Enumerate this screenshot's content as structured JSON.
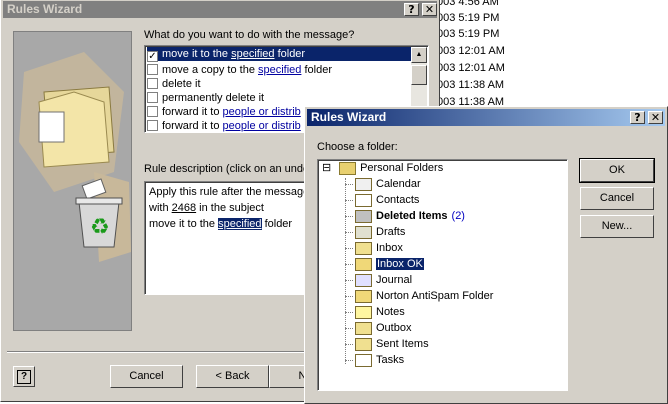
{
  "background_list": {
    "times": [
      "003 4:56 AM",
      "003 5:19 PM",
      "003 5:19 PM",
      "003 12:01 AM",
      "003 12:01 AM",
      "003 11:38 AM",
      "003 11:38 AM"
    ]
  },
  "rules_wizard": {
    "title": "Rules Wizard",
    "help_btn": "?",
    "close_btn": "✕",
    "question": "What do you want to do with the message?",
    "actions": [
      {
        "pre": "move it to the ",
        "link": "specified",
        "post": " folder",
        "checked": "✓"
      },
      {
        "pre": "move a copy to the ",
        "link": "specified",
        "post": " folder",
        "checked": ""
      },
      {
        "pre": "delete it",
        "link": "",
        "post": "",
        "checked": ""
      },
      {
        "pre": "permanently delete it",
        "link": "",
        "post": "",
        "checked": ""
      },
      {
        "pre": "forward it to ",
        "link": "people or distrib",
        "post": "",
        "checked": ""
      },
      {
        "pre": "forward it to ",
        "link": "people or distrib",
        "post": "",
        "checked": ""
      }
    ],
    "description_label": "Rule description (click on an unde",
    "description": {
      "line1": "Apply this rule after the message",
      "line2_pre": "with ",
      "line2_link": "2468",
      "line2_post": " in the subject",
      "line3_pre": "move it to the ",
      "line3_link": "specified",
      "line3_post": " folder"
    },
    "buttons": {
      "cancel": "Cancel",
      "back": "< Back",
      "next": "Ne"
    }
  },
  "folder_dialog": {
    "title": "Rules Wizard",
    "help_btn": "?",
    "close_btn": "✕",
    "prompt": "Choose a folder:",
    "tree_expander": "⊟",
    "root": "Personal Folders",
    "folders": [
      {
        "name": "Calendar",
        "icon": "calendar-icon",
        "bold": false,
        "count": ""
      },
      {
        "name": "Contacts",
        "icon": "contacts-icon",
        "bold": false,
        "count": ""
      },
      {
        "name": "Deleted Items",
        "icon": "deleted-items-icon",
        "bold": true,
        "count": "(2)"
      },
      {
        "name": "Drafts",
        "icon": "drafts-icon",
        "bold": false,
        "count": ""
      },
      {
        "name": "Inbox",
        "icon": "inbox-icon",
        "bold": false,
        "count": ""
      },
      {
        "name": "Inbox OK",
        "icon": "folder-icon",
        "bold": false,
        "count": "",
        "selected": true
      },
      {
        "name": "Journal",
        "icon": "journal-icon",
        "bold": false,
        "count": ""
      },
      {
        "name": "Norton AntiSpam Folder",
        "icon": "folder-icon",
        "bold": false,
        "count": ""
      },
      {
        "name": "Notes",
        "icon": "notes-icon",
        "bold": false,
        "count": ""
      },
      {
        "name": "Outbox",
        "icon": "outbox-icon",
        "bold": false,
        "count": ""
      },
      {
        "name": "Sent Items",
        "icon": "sent-items-icon",
        "bold": false,
        "count": ""
      },
      {
        "name": "Tasks",
        "icon": "tasks-icon",
        "bold": false,
        "count": ""
      }
    ],
    "buttons": {
      "ok": "OK",
      "cancel": "Cancel",
      "new": "New..."
    }
  },
  "colors": {
    "selection": "#0a246a",
    "face": "#d4d0c8",
    "link": "#0000a0"
  }
}
